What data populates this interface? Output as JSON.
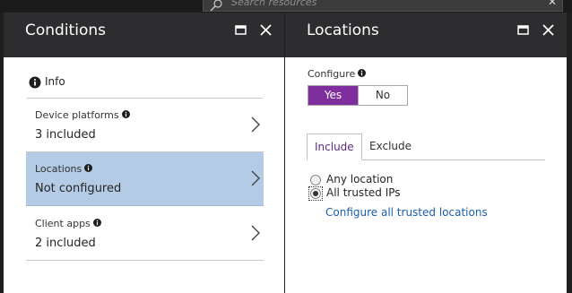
{
  "search": {
    "placeholder": "Search resources"
  },
  "conditions": {
    "title": "Conditions",
    "info_label": "Info",
    "items": [
      {
        "label": "Device platforms",
        "value": "3 included"
      },
      {
        "label": "Locations",
        "value": "Not configured",
        "selected": true
      },
      {
        "label": "Client apps",
        "value": "2 included"
      }
    ]
  },
  "locations": {
    "title": "Locations",
    "configure_label": "Configure",
    "toggle": {
      "yes": "Yes",
      "no": "No",
      "selected": "Yes"
    },
    "tabs": [
      {
        "label": "Include",
        "active": true
      },
      {
        "label": "Exclude",
        "active": false
      }
    ],
    "radios": [
      {
        "label": "Any location",
        "checked": false
      },
      {
        "label": "All trusted IPs",
        "checked": true
      }
    ],
    "link_text": "Configure all trusted locations"
  },
  "colors": {
    "accent": "#7f2e9e",
    "selected_row": "#b3cbe4",
    "header": "#2d2d30",
    "link": "#1a5faa"
  }
}
